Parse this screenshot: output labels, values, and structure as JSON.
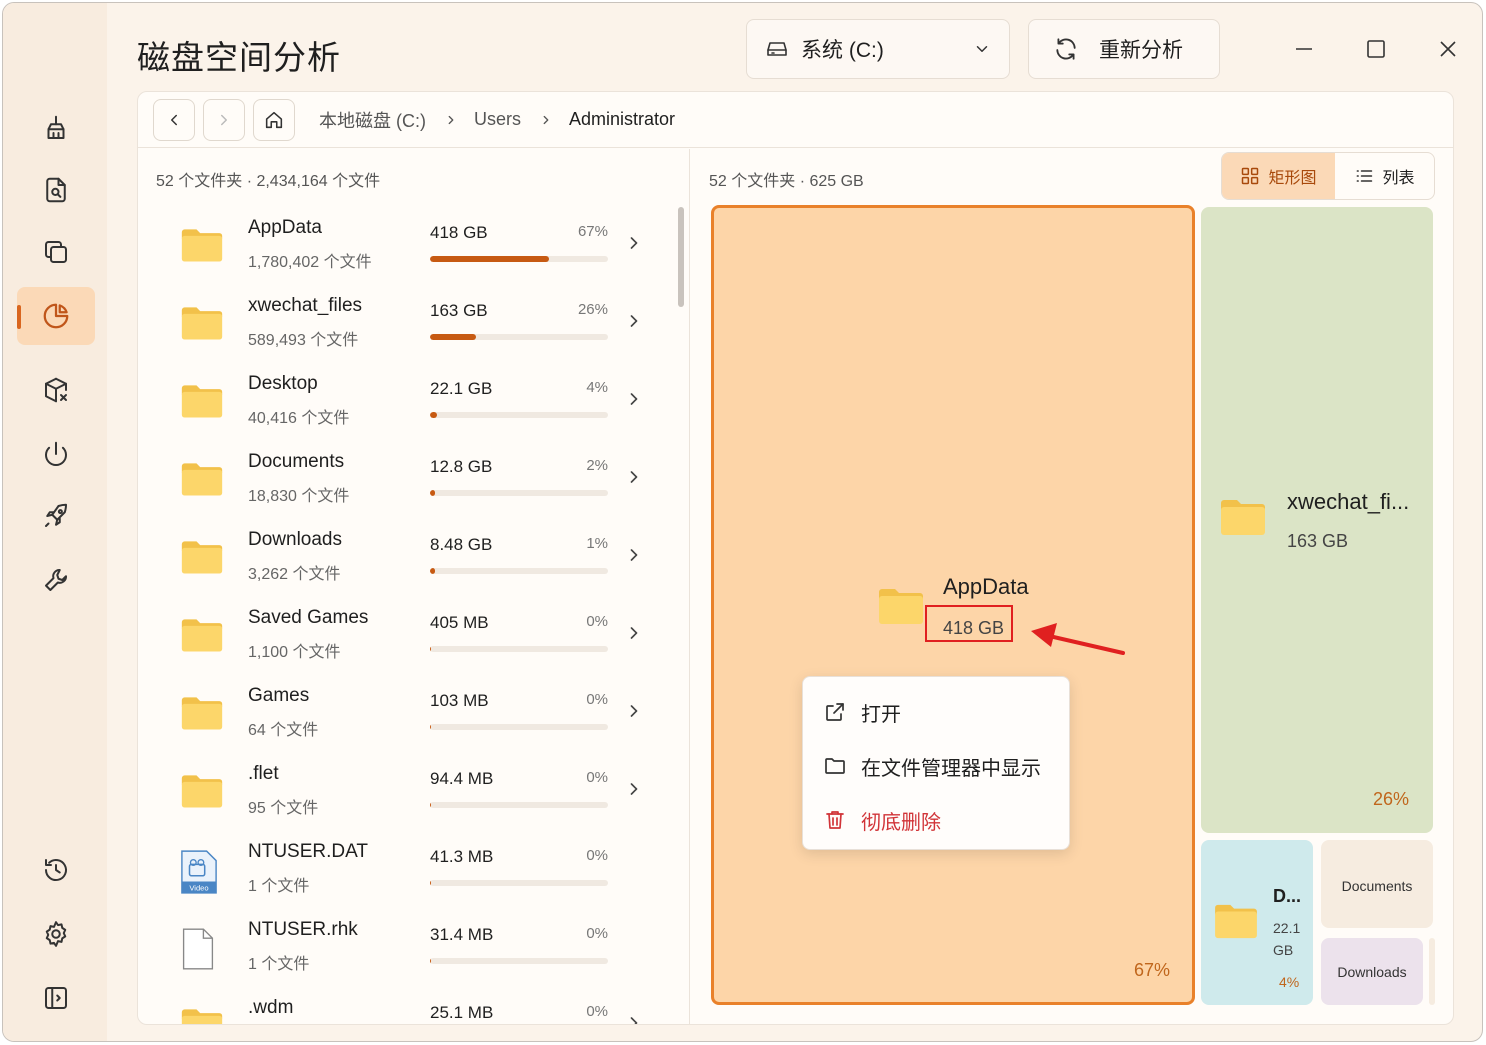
{
  "app": {
    "title": "磁盘空间分析"
  },
  "titlebar": {
    "drive_label": "系统 (C:)",
    "reanalyze_label": "重新分析"
  },
  "sidebar": {
    "items": [
      {
        "icon": "broom-icon",
        "active": false
      },
      {
        "icon": "file-search-icon",
        "active": false
      },
      {
        "icon": "duplicate-icon",
        "active": false
      },
      {
        "icon": "pie-chart-icon",
        "active": true
      },
      {
        "icon": "package-remove-icon",
        "active": false
      },
      {
        "icon": "power-icon",
        "active": false
      },
      {
        "icon": "rocket-icon",
        "active": false
      },
      {
        "icon": "wrench-icon",
        "active": false
      },
      {
        "icon": "history-icon",
        "active": false
      },
      {
        "icon": "gear-icon",
        "active": false
      },
      {
        "icon": "panel-toggle-icon",
        "active": false
      }
    ]
  },
  "breadcrumb": [
    "本地磁盘 (C:)",
    "Users",
    "Administrator"
  ],
  "list": {
    "summary": "52 个文件夹 · 2,434,164 个文件",
    "rows": [
      {
        "name": "AppData",
        "count": "1,780,402 个文件",
        "size": "418 GB",
        "pct": "67%",
        "fraction": 0.67,
        "kind": "folder",
        "has_children": true
      },
      {
        "name": "xwechat_files",
        "count": "589,493 个文件",
        "size": "163 GB",
        "pct": "26%",
        "fraction": 0.26,
        "kind": "folder",
        "has_children": true
      },
      {
        "name": "Desktop",
        "count": "40,416 个文件",
        "size": "22.1 GB",
        "pct": "4%",
        "fraction": 0.04,
        "kind": "folder",
        "has_children": true
      },
      {
        "name": "Documents",
        "count": "18,830 个文件",
        "size": "12.8 GB",
        "pct": "2%",
        "fraction": 0.02,
        "kind": "folder",
        "has_children": true
      },
      {
        "name": "Downloads",
        "count": "3,262 个文件",
        "size": "8.48 GB",
        "pct": "1%",
        "fraction": 0.01,
        "kind": "folder",
        "has_children": true
      },
      {
        "name": "Saved Games",
        "count": "1,100 个文件",
        "size": "405 MB",
        "pct": "0%",
        "fraction": 0.0,
        "kind": "folder",
        "has_children": true
      },
      {
        "name": "Games",
        "count": "64 个文件",
        "size": "103 MB",
        "pct": "0%",
        "fraction": 0.0,
        "kind": "folder",
        "has_children": true
      },
      {
        "name": ".flet",
        "count": "95 个文件",
        "size": "94.4 MB",
        "pct": "0%",
        "fraction": 0.0,
        "kind": "folder",
        "has_children": true
      },
      {
        "name": "NTUSER.DAT",
        "count": "1 个文件",
        "size": "41.3 MB",
        "pct": "0%",
        "fraction": 0.0,
        "kind": "video-file",
        "has_children": false
      },
      {
        "name": "NTUSER.rhk",
        "count": "1 个文件",
        "size": "31.4 MB",
        "pct": "0%",
        "fraction": 0.0,
        "kind": "file",
        "has_children": false
      },
      {
        "name": ".wdm",
        "count": "",
        "size": "25.1 MB",
        "pct": "0%",
        "fraction": 0.0,
        "kind": "folder",
        "has_children": true
      }
    ]
  },
  "treemap": {
    "summary": "52 个文件夹 · 625 GB",
    "view_treemap_label": "矩形图",
    "view_list_label": "列表",
    "tiles": {
      "appdata": {
        "name": "AppData",
        "size": "418 GB",
        "pct": "67%"
      },
      "xwechat": {
        "name": "xwechat_fi...",
        "size": "163 GB",
        "pct": "26%"
      },
      "desktop": {
        "name": "D...",
        "size_line1": "22.1",
        "size_line2": "GB",
        "pct": "4%"
      },
      "documents": {
        "name": "Documents"
      },
      "downloads": {
        "name": "Downloads"
      }
    }
  },
  "context_menu": {
    "open": "打开",
    "show_in_explorer": "在文件管理器中显示",
    "delete": "彻底删除"
  },
  "video_badge": "Video",
  "colors": {
    "accent": "#d9661f",
    "bar_fill": "#c75a12",
    "appdata_tile": "#fdd5a8",
    "xwechat_tile": "#dbe4c6",
    "desktop_tile": "#cfeaec",
    "danger": "#d13438",
    "annotation": "#e02020"
  }
}
